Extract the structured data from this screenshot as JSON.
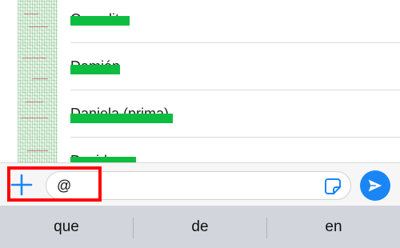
{
  "mentions": [
    {
      "name": "Camelita"
    },
    {
      "name": "Damián"
    },
    {
      "name": "Daniela (prima)"
    },
    {
      "name": "David"
    }
  ],
  "composer": {
    "input_value": "@",
    "add_icon": "plus-icon",
    "sticker_icon": "sticker-icon",
    "send_icon": "send-icon",
    "accent_color": "#1a86f5"
  },
  "keyboard": {
    "suggestions": [
      "que",
      "de",
      "en"
    ]
  },
  "annotation": {
    "highlight_color": "#ff0000"
  }
}
